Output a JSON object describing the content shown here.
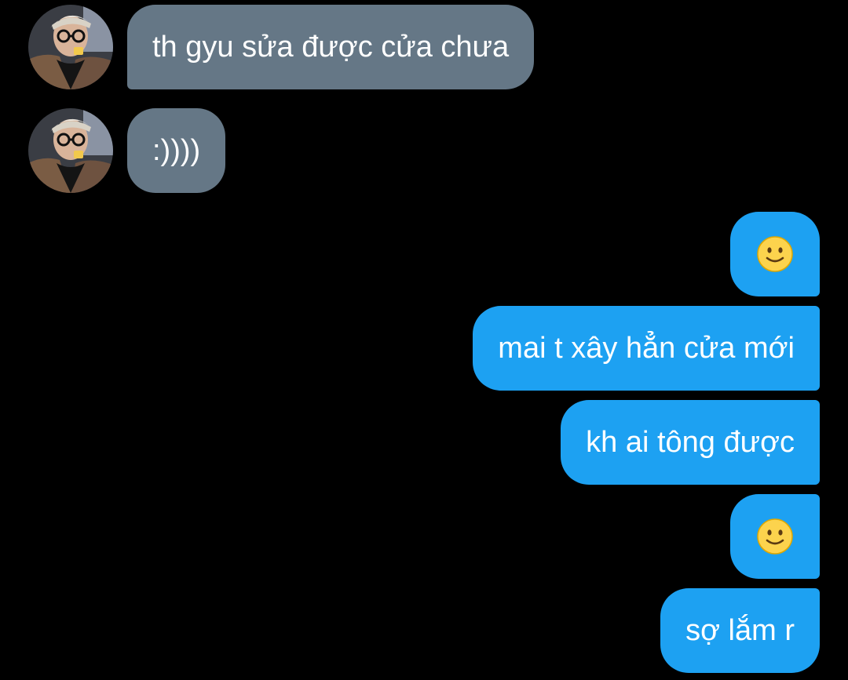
{
  "conversation": {
    "messages": [
      {
        "direction": "incoming",
        "text": "th gyu sửa được cửa chưa"
      },
      {
        "direction": "incoming",
        "text": ":))))"
      },
      {
        "direction": "outgoing",
        "emoji": "slightly-smiling-face"
      },
      {
        "direction": "outgoing",
        "text": "mai t xây hẳn cửa mới"
      },
      {
        "direction": "outgoing",
        "text": "kh ai tông được"
      },
      {
        "direction": "outgoing",
        "emoji": "slightly-smiling-face"
      },
      {
        "direction": "outgoing",
        "text": "sợ lắm r"
      }
    ]
  },
  "colors": {
    "background": "#000000",
    "incoming_bubble": "#657786",
    "outgoing_bubble": "#1da1f2",
    "text": "#ffffff"
  }
}
